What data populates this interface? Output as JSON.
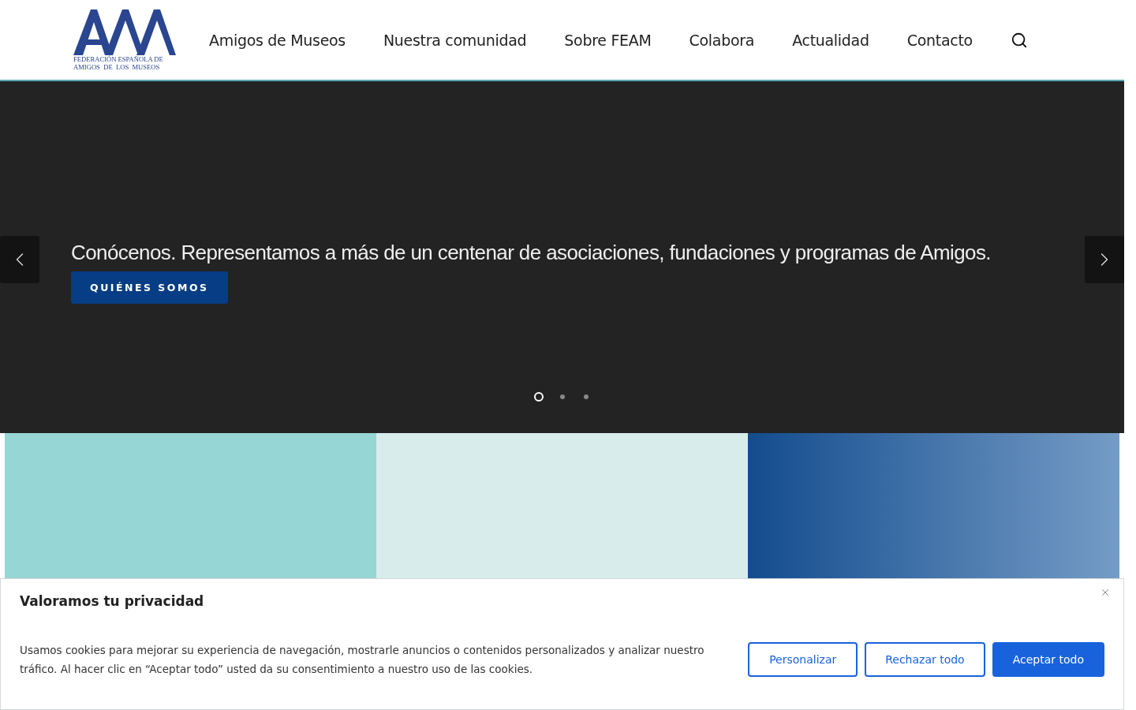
{
  "logo": {
    "lines": [
      "FEDERACIÓN ESPAÑOLA DE",
      "AMIGOS  DE  LOS  MUSEOS"
    ]
  },
  "nav": [
    {
      "label": "Amigos de Museos"
    },
    {
      "label": "Nuestra comunidad"
    },
    {
      "label": "Sobre FEAM"
    },
    {
      "label": "Colabora"
    },
    {
      "label": "Actualidad"
    },
    {
      "label": "Contacto"
    }
  ],
  "hero": {
    "caption": "Conócenos. Representamos a más de un centenar de asociaciones, fundaciones y programas de Amigos.",
    "button": "QUIÉNES SOMOS",
    "dots": [
      {
        "selected": true
      },
      {
        "selected": false
      },
      {
        "selected": false
      }
    ]
  },
  "tiles": [
    {
      "kind": "teal"
    },
    {
      "kind": "pale"
    },
    {
      "kind": "blue"
    }
  ],
  "cookie_banner": {
    "title": "Valoramos tu privacidad",
    "text": "Usamos cookies para mejorar su experiencia de navegación, mostrarle anuncios o contenidos personalizados y analizar nuestro tráfico. Al hacer clic en “Aceptar todo” usted da su consentimiento a nuestro uso de las cookies.",
    "buttons": [
      {
        "label": "Personalizar",
        "kind": "outline"
      },
      {
        "label": "Rechazar todo",
        "kind": "outline"
      },
      {
        "label": "Aceptar todo",
        "kind": "primary"
      }
    ]
  }
}
